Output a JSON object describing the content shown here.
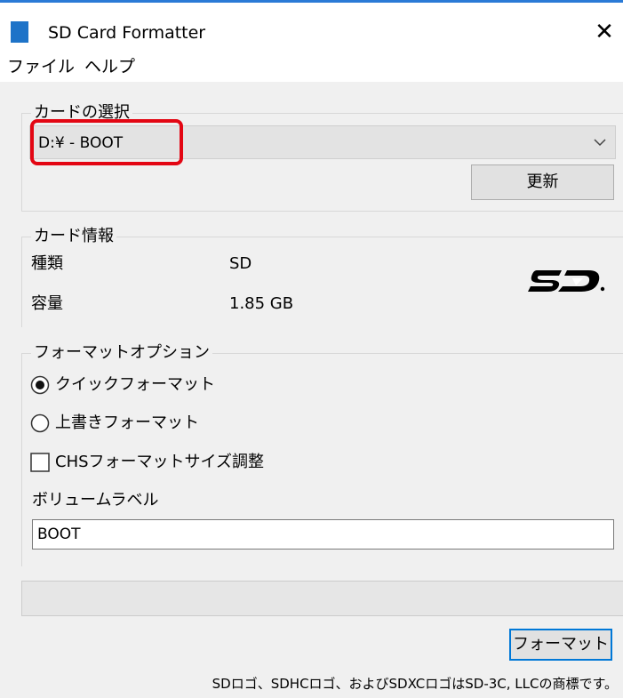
{
  "window": {
    "title": "SD Card Formatter",
    "close_glyph": "✕"
  },
  "menu": {
    "items": [
      {
        "label": "ファイル"
      },
      {
        "label": "ヘルプ"
      }
    ]
  },
  "card_select": {
    "legend": "カードの選択",
    "selected_value": "D:¥ - BOOT",
    "refresh_label": "更新"
  },
  "card_info": {
    "legend": "カード情報",
    "type_label": "種類",
    "type_value": "SD",
    "capacity_label": "容量",
    "capacity_value": "1.85 GB"
  },
  "format_options": {
    "legend": "フォーマットオプション",
    "quick_label": "クイックフォーマット",
    "quick_selected": true,
    "overwrite_label": "上書きフォーマット",
    "overwrite_selected": false,
    "chs_label": "CHSフォーマットサイズ調整",
    "chs_checked": false,
    "volume_label_caption": "ボリュームラベル",
    "volume_label_value": "BOOT"
  },
  "actions": {
    "format_label": "フォーマット"
  },
  "footer": {
    "trademark_text": "SDロゴ、SDHCロゴ、およびSDXCロゴはSD-3C, LLCの商標です。"
  },
  "colors": {
    "title_accent": "#2a7ad6",
    "highlight_border": "#e30613",
    "window_bg": "#f0f0f0"
  },
  "icons": {
    "app": "sd-card-icon",
    "dropdown": "chevron-down-icon",
    "logo": "sd-logo"
  }
}
